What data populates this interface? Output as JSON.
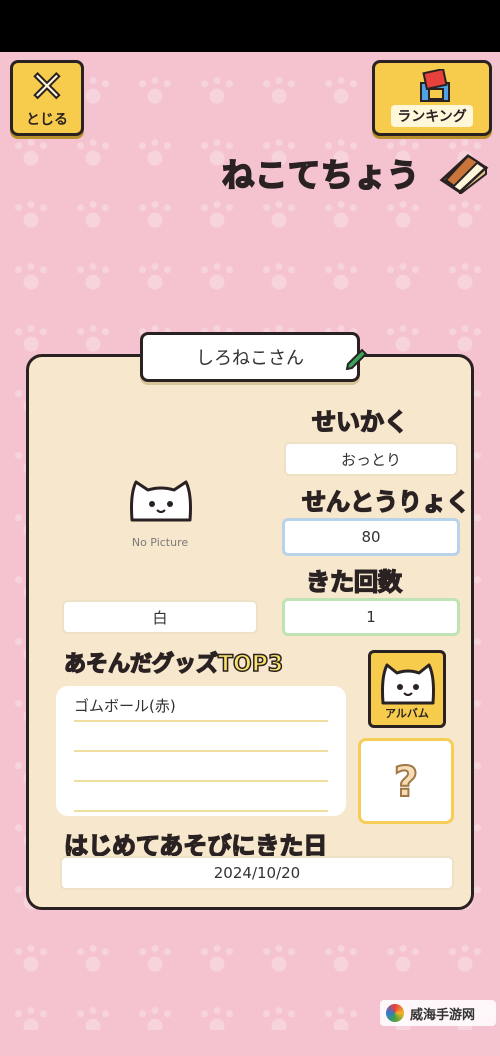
{
  "header": {
    "close_label": "とじる",
    "ranking_label": "ランキング",
    "title": "ねこてちょう"
  },
  "profile": {
    "name": "しろねこさん",
    "picture_placeholder": "No Picture",
    "color_value": "白"
  },
  "stats": {
    "personality_label": "せいかく",
    "personality_value": "おっとり",
    "power_label": "せんとうりょく",
    "power_value": "80",
    "visits_label": "きた回数",
    "visits_value": "1"
  },
  "goods": {
    "heading": "あそんだグッズTOP3",
    "items": [
      "ゴムボール(赤)",
      "",
      "",
      ""
    ],
    "album_label": "アルバム",
    "mystery_symbol": "?"
  },
  "first_visit": {
    "label": "はじめてあそびにきた日",
    "date": "2024/10/20"
  },
  "watermark": {
    "text": "威海手游网"
  },
  "colors": {
    "background": "#f4c3cf",
    "panel": "#f7e7cc",
    "button": "#f7cc4c",
    "label_yellow": "#f9e36b",
    "outline": "#2a2222"
  }
}
